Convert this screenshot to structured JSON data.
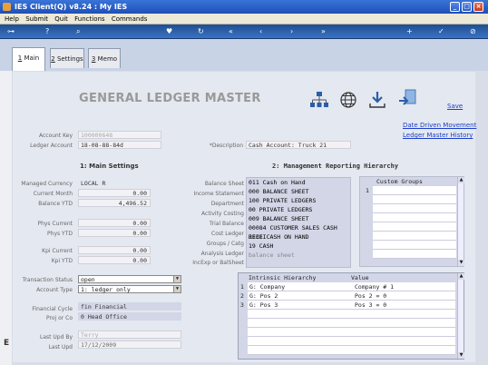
{
  "window": {
    "title": "IES Client(Q) v8.24 : My IES"
  },
  "menu": [
    "Help",
    "Submit",
    "Quit",
    "Functions",
    "Commands"
  ],
  "tabs": [
    {
      "num": "1",
      "label": "Main"
    },
    {
      "num": "2",
      "label": "Settings"
    },
    {
      "num": "3",
      "label": "Memo"
    }
  ],
  "page": {
    "title": "GENERAL LEDGER MASTER",
    "save_label": "Save",
    "links": [
      "Date Driven Movement",
      "Ledger Master History"
    ]
  },
  "header_fields": {
    "account_key": {
      "label": "Account Key",
      "value": "100000648"
    },
    "ledger_account": {
      "label": "Ledger Account",
      "value": "18-08-88-84d"
    },
    "description": {
      "label": "*Description",
      "value": "Cash Account: Truck 21"
    }
  },
  "main_settings": {
    "heading": "1: Main Settings",
    "fields": [
      {
        "label": "Managed Currency",
        "value": "LOCAL R"
      },
      {
        "label": "Current Month",
        "value": "0.00"
      },
      {
        "label": "Balance YTD",
        "value": "4,496.52"
      },
      {
        "label": "Phys Current",
        "value": "0.00"
      },
      {
        "label": "Phys YTD",
        "value": "0.00"
      },
      {
        "label": "Kpi Current",
        "value": "0.00"
      },
      {
        "label": "Kpi YTD",
        "value": "0.00"
      }
    ],
    "transaction_status": {
      "label": "Transaction Status",
      "value": "open"
    },
    "account_type": {
      "label": "Account Type",
      "value": "1: ledger only"
    },
    "financial_cycle": {
      "label": "Financial Cycle",
      "value": "fin Financial"
    },
    "proj_or_co": {
      "label": "Proj or Co",
      "value": "0 Head Office"
    },
    "last_upd_by": {
      "label": "Last Upd By",
      "value": "Terry"
    },
    "last_upd": {
      "label": "Last Upd",
      "value": "17/12/2009"
    }
  },
  "mgmt": {
    "heading": "2: Management Reporting Hierarchy",
    "rows": [
      {
        "label": "Balance Sheet",
        "value": "011 Cash on Hand"
      },
      {
        "label": "Income Statement",
        "value": "000 BALANCE SHEET"
      },
      {
        "label": "Department",
        "value": "100 PRIVATE LEDGERS"
      },
      {
        "label": "Activity Costing",
        "value": "00 PRIVATE LEDGERS"
      },
      {
        "label": "Trial Balance",
        "value": "009 BALANCE SHEET"
      },
      {
        "label": "Cost Ledger",
        "value": "00084 CUSTOMER SALES CASH RECEI"
      },
      {
        "label": "Groups / Catg",
        "value": "J131 CASH ON HAND"
      },
      {
        "label": "Analysis Ledger",
        "value": "19 CASH"
      },
      {
        "label": "IncExp or BalSheet",
        "value": "balance sheet"
      }
    ],
    "custom_groups": {
      "header": "Custom Groups",
      "rows": [
        {
          "num": "1",
          "value": ""
        }
      ]
    }
  },
  "intrinsic": {
    "col1": "Intrinsic Hierarchy",
    "col2": "Value",
    "rows": [
      {
        "num": "1",
        "name": "G: Company",
        "value": "Company # 1"
      },
      {
        "num": "2",
        "name": "G: Pos 2",
        "value": "Pos 2 = 0"
      },
      {
        "num": "3",
        "name": "G: Pos 3",
        "value": "Pos 3 = 0"
      }
    ]
  },
  "colors": {
    "title_bar": "#1d4fb8",
    "toolbar": "#2b5ea8",
    "link": "#1a3fcc",
    "background": "#dfe4ea"
  }
}
